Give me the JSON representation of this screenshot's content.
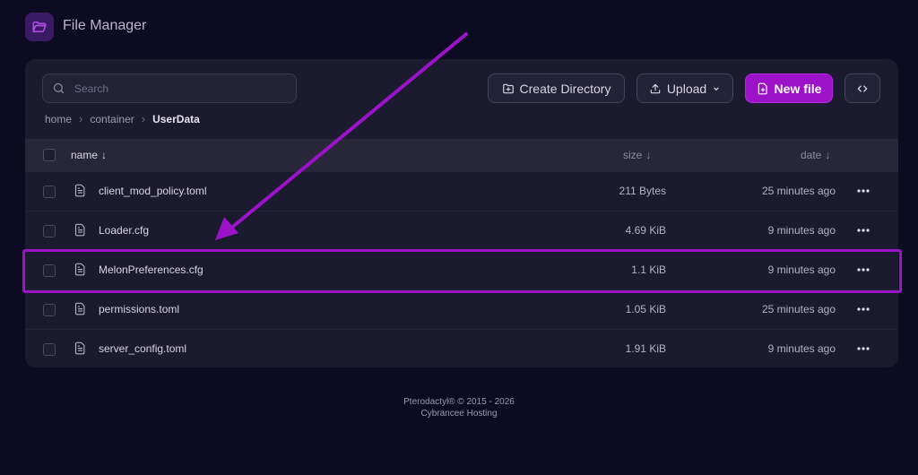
{
  "app": {
    "title": "File Manager"
  },
  "toolbar": {
    "search_placeholder": "Search",
    "create_directory": "Create Directory",
    "upload": "Upload",
    "new_file": "New file"
  },
  "breadcrumb": {
    "items": [
      "home",
      "container",
      "UserData"
    ]
  },
  "table": {
    "columns": {
      "name": "name",
      "size": "size",
      "date": "date"
    },
    "rows": [
      {
        "name": "client_mod_policy.toml",
        "size": "211 Bytes",
        "date": "25 minutes ago"
      },
      {
        "name": "Loader.cfg",
        "size": "4.69 KiB",
        "date": "9 minutes ago"
      },
      {
        "name": "MelonPreferences.cfg",
        "size": "1.1 KiB",
        "date": "9 minutes ago"
      },
      {
        "name": "permissions.toml",
        "size": "1.05 KiB",
        "date": "25 minutes ago"
      },
      {
        "name": "server_config.toml",
        "size": "1.91 KiB",
        "date": "9 minutes ago"
      }
    ]
  },
  "footer": {
    "line1": "Pterodactyl® © 2015 - 2026",
    "line2": "Cybrancee Hosting"
  },
  "icons": {
    "app": "folder-open-icon",
    "search": "search-icon",
    "create_directory": "folder-plus-icon",
    "upload": "upload-icon",
    "upload_caret": "chevron-down-icon",
    "new_file": "file-plus-icon",
    "code": "code-icon",
    "file": "file-text-icon",
    "more": "more-horizontal-icon",
    "sort": "arrow-down-icon"
  },
  "colors": {
    "background": "#0d0b22",
    "panel": "#1b1a2e",
    "accent": "#9d12c9",
    "highlight": "#9a13c8"
  }
}
